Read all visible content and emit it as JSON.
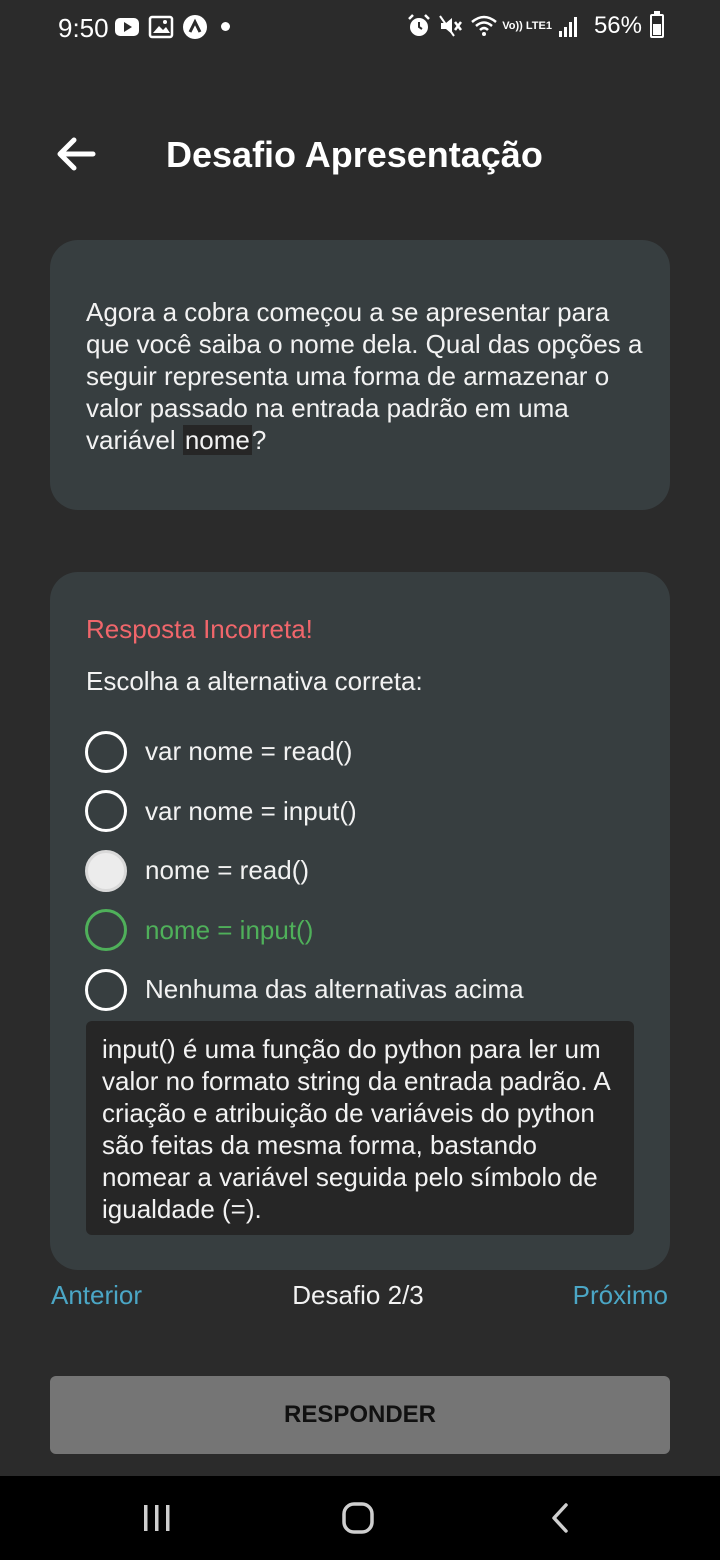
{
  "status_bar": {
    "time": "9:50",
    "lte_label": "Vo)) LTE1",
    "battery_text": "56%"
  },
  "header": {
    "title": "Desafio Apresentação"
  },
  "question": {
    "text_before": "Agora a cobra começou a se apresentar para que você saiba o nome dela. Qual das opções a seguir representa uma forma de armazenar o valor passado na entrada padrão em uma variável ",
    "code": "nome",
    "text_after": "?"
  },
  "answer": {
    "feedback": "Resposta Incorreta!",
    "instruction": "Escolha a alternativa correta:",
    "options": [
      {
        "label": "var nome = read()",
        "state": "default"
      },
      {
        "label": "var nome = input()",
        "state": "default"
      },
      {
        "label": "nome = read()",
        "state": "selected"
      },
      {
        "label": "nome = input()",
        "state": "correct"
      },
      {
        "label": "Nenhuma das alternativas acima",
        "state": "default"
      }
    ],
    "explanation": "input() é uma função do python para ler um valor no formato string da entrada padrão. A criação e atribuição de variáveis do python são feitas da mesma forma, bastando nomear a variável seguida pelo símbolo de igualdade (=)."
  },
  "navigation": {
    "prev_label": "Anterior",
    "counter": "Desafio 2/3",
    "next_label": "Próximo"
  },
  "actions": {
    "respond_label": "RESPONDER"
  },
  "colors": {
    "background": "#2b2b2b",
    "card": "#373e40",
    "incorrect": "#f0666b",
    "correct": "#4fb05a",
    "link": "#4ba6c5",
    "button": "#757575"
  }
}
